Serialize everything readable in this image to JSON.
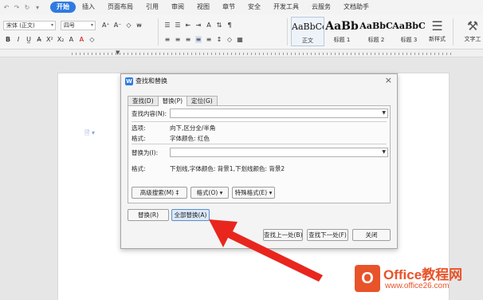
{
  "menubar": {
    "quick_access": [
      "↶",
      "↷",
      "↻",
      "▾"
    ],
    "tabs": [
      "开始",
      "插入",
      "页面布局",
      "引用",
      "审阅",
      "视图",
      "章节",
      "安全",
      "开发工具",
      "云服务",
      "文档助手"
    ],
    "active_tab": "开始"
  },
  "ribbon": {
    "font_name": "宋体 (正文)",
    "font_size": "四号",
    "row1_left": [
      "A⁺",
      "A⁻",
      "◇",
      "w̶"
    ],
    "row2_left": [
      "B",
      "I",
      "U̲",
      "A̶",
      "X²",
      "X₂",
      "A",
      "A",
      "◇"
    ],
    "row1_mid": [
      "☰",
      "☰",
      "⇤",
      "⇥",
      "A",
      "⇅",
      "¶"
    ],
    "row2_mid": [
      "≡",
      "≡",
      "≡",
      "≡",
      "≡",
      "↕",
      "◇",
      "▦"
    ],
    "styles": [
      {
        "preview": "AaBbCcI",
        "label": "正文"
      },
      {
        "preview": "AaBb",
        "label": "标题 1"
      },
      {
        "preview": "AaBbC",
        "label": "标题 2"
      },
      {
        "preview": "AaBbC",
        "label": "标题 3"
      }
    ],
    "new_style": "新样式",
    "text_tools": "文字工"
  },
  "ruler": {
    "marks": [
      "12",
      "",
      "4",
      "",
      "6",
      "",
      "8",
      "10",
      "12",
      "14",
      "16",
      "18",
      "20",
      "22",
      "24",
      "26",
      "",
      "28",
      "",
      "30"
    ]
  },
  "dialog": {
    "title": "查找和替换",
    "close": "×",
    "tabs": [
      "查找(D)",
      "替换(P)",
      "定位(G)"
    ],
    "find_label": "查找内容(N):",
    "options_label": "选项:",
    "options_value": "向下,区分全/半角",
    "format_label1": "格式:",
    "format_value1": "字体颜色: 红色",
    "replace_label": "替换为(I):",
    "format_label2": "格式:",
    "format_value2": "下划线,字体颜色: 背景1,下划线颜色: 背景2",
    "advanced_btn": "高级搜索(M) ‡",
    "format_btn": "格式(O) ▾",
    "special_btn": "特殊格式(E) ▾",
    "replace_btn": "替换(R)",
    "replace_all_btn": "全部替换(A)",
    "find_prev_btn": "查找上一处(B)",
    "find_next_btn": "查找下一处(F)",
    "close_btn": "关闭"
  },
  "watermark": {
    "logo": "O",
    "name": "Office教程网",
    "url": "www.office26.com"
  },
  "colors": {
    "accent": "#2f7be0",
    "arrow": "#e8261e",
    "watermark": "#e8532a"
  }
}
